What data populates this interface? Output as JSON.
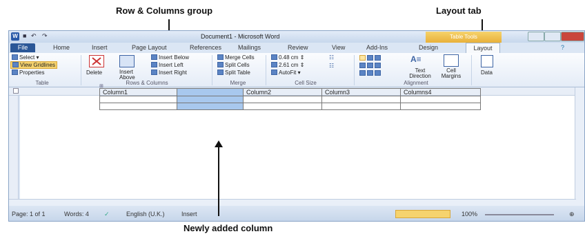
{
  "annotations": {
    "rows_columns_group": "Row & Columns group",
    "layout_tab": "Layout tab",
    "newly_added_column": "Newly added column"
  },
  "window": {
    "title": "Document1 - Microsoft Word",
    "table_tools": "Table Tools"
  },
  "tabs": [
    "File",
    "Home",
    "Insert",
    "Page Layout",
    "References",
    "Mailings",
    "Review",
    "View",
    "Add-Ins",
    "Design",
    "Layout"
  ],
  "ribbon": {
    "select": "Select",
    "view_gridlines": "View Gridlines",
    "properties": "Properties",
    "table_group": "Table",
    "delete": "Delete",
    "insert_above": "Insert Above",
    "insert_below": "Insert Below",
    "insert_left": "Insert Left",
    "insert_right": "Insert Right",
    "rows_columns_group": "Rows & Columns",
    "merge_cells": "Merge Cells",
    "split_cells": "Split Cells",
    "split_table": "Split Table",
    "merge_group": "Merge",
    "height": "0.48 cm",
    "width": "2.61 cm",
    "autofit": "AutoFit",
    "cell_size_group": "Cell Size",
    "text_direction": "Text Direction",
    "cell_margins": "Cell Margins",
    "alignment_group": "Alignment",
    "data": "Data"
  },
  "table": {
    "headers": [
      "Column1",
      "",
      "Column2",
      "Column3",
      "Columns4"
    ],
    "rows": 3
  },
  "status": {
    "page": "Page: 1 of 1",
    "words": "Words: 4",
    "language": "English (U.K.)",
    "mode": "Insert",
    "zoom": "100%"
  },
  "colors": {
    "file_tab": "#2b5797",
    "new_column": "#a8c8ee",
    "table_tools": "#e8b13a"
  }
}
